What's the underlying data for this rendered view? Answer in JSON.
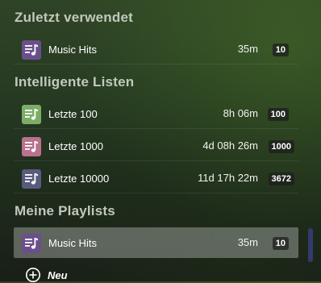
{
  "sections": {
    "recent": {
      "title": "Zuletzt verwendet",
      "items": [
        {
          "label": "Music Hits",
          "duration": "35m",
          "count": "10",
          "icon_color": "#6b4f8c",
          "icon": "playlist-music-icon"
        }
      ]
    },
    "smart": {
      "title": "Intelligente Listen",
      "items": [
        {
          "label": "Letzte 100",
          "duration": "8h 06m",
          "count": "100",
          "icon_color": "#7cad67",
          "icon": "playlist-music-icon"
        },
        {
          "label": "Letzte 1000",
          "duration": "4d 08h 26m",
          "count": "1000",
          "icon_color": "#b9718e",
          "icon": "playlist-music-icon"
        },
        {
          "label": "Letzte 10000",
          "duration": "11d 17h 22m",
          "count": "3672",
          "icon_color": "#5a5a7e",
          "icon": "playlist-music-icon"
        }
      ]
    },
    "playlists": {
      "title": "Meine Playlists",
      "items": [
        {
          "label": "Music Hits",
          "duration": "35m",
          "count": "10",
          "icon_color": "#6b4f8c",
          "icon": "playlist-music-icon",
          "selected": true
        }
      ],
      "new_label": "Neu",
      "new_icon": "plus-circle-icon"
    }
  }
}
